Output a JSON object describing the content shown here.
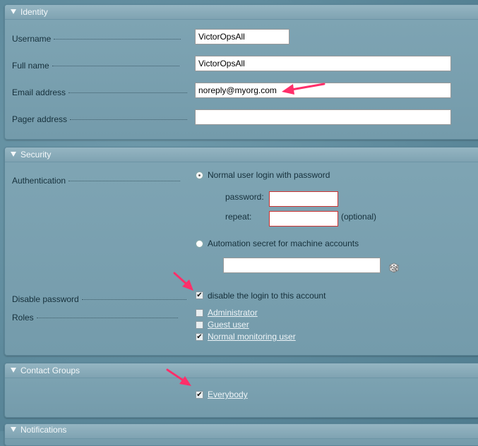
{
  "identity": {
    "title": "Identity",
    "username_label": "Username",
    "username_value": "VictorOpsAll",
    "fullname_label": "Full name",
    "fullname_value": "VictorOpsAll",
    "email_label": "Email address",
    "email_value": "noreply@myorg.com",
    "pager_label": "Pager address",
    "pager_value": ""
  },
  "security": {
    "title": "Security",
    "auth_label": "Authentication",
    "normal_login": "Normal user login with password",
    "password_label": "password:",
    "repeat_label": "repeat:",
    "optional": "(optional)",
    "automation": "Automation secret for machine accounts",
    "secret_value": "",
    "disable_label": "Disable password",
    "disable_text": "disable the login to this account",
    "roles_label": "Roles",
    "roles": [
      {
        "label": "Administrator",
        "checked": false
      },
      {
        "label": "Guest user",
        "checked": false
      },
      {
        "label": "Normal monitoring user",
        "checked": true
      }
    ]
  },
  "contact_groups": {
    "title": "Contact Groups",
    "group": "Everybody"
  },
  "notifications": {
    "title": "Notifications"
  },
  "colors": {
    "arrow": "#ff2f6a",
    "accent": "#7fa5b4"
  }
}
